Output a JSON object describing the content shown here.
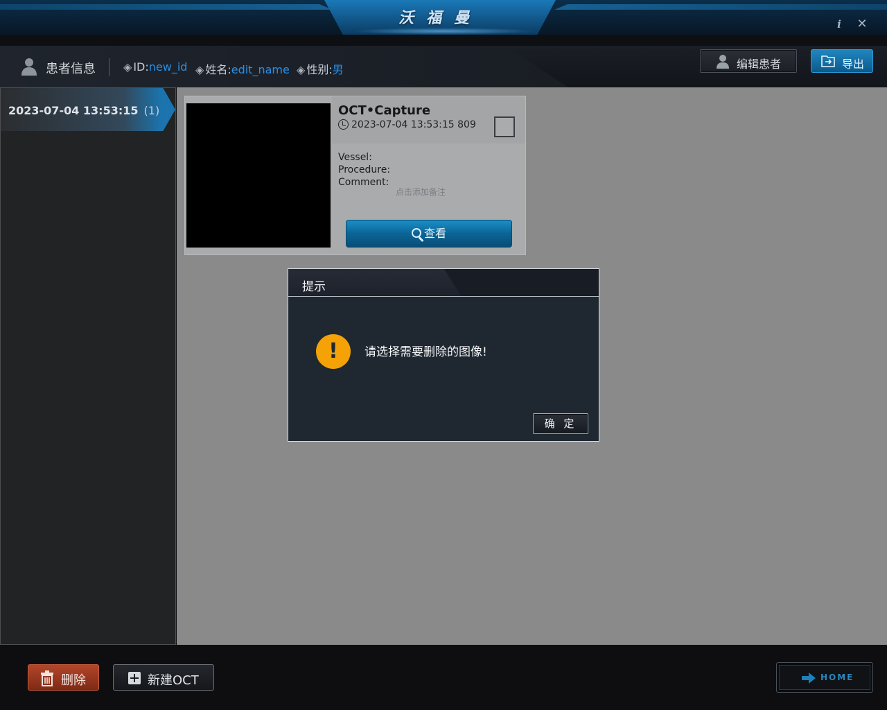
{
  "app": {
    "brand": "沃福曼",
    "window_controls": {
      "info": "i",
      "close": "✕"
    }
  },
  "patient": {
    "section_title": "患者信息",
    "fields": [
      {
        "label": "ID:",
        "value": "new_id"
      },
      {
        "label": "姓名:",
        "value": "edit_name"
      },
      {
        "label": "性别:",
        "value": "男"
      }
    ],
    "edit_button": "编辑患者",
    "export_button": "导出"
  },
  "sessions": [
    {
      "date": "2023-07-04 13:53:15",
      "count": "(1)"
    }
  ],
  "capture_card": {
    "title": "OCT•Capture",
    "timestamp": "2023-07-04 13:53:15 809",
    "vessel_label": "Vessel:",
    "procedure_label": "Procedure:",
    "comment_label": "Comment:",
    "comment_placeholder": "点击添加备注",
    "view_button": "查看",
    "selected": false
  },
  "dialog": {
    "title": "提示",
    "icon": "warning-icon",
    "message": "请选择需要删除的图像!",
    "ok_button": "确 定"
  },
  "footer": {
    "delete_button": "删除",
    "new_oct_button": "新建OCT",
    "home_button": "HOME"
  },
  "colors": {
    "accent_blue": "#1b74ad",
    "link_blue": "#2a8fe6",
    "delete_red": "#b2462a",
    "warning_orange": "#f5a207"
  }
}
